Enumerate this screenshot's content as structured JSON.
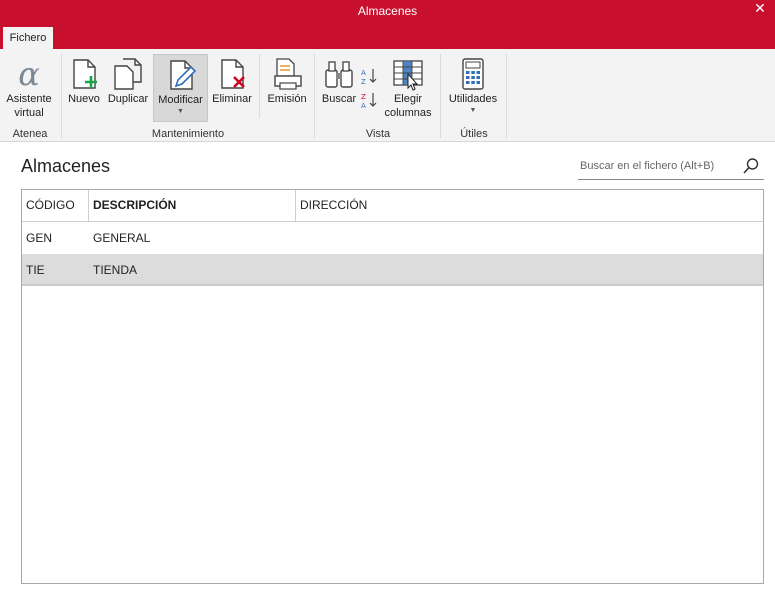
{
  "window": {
    "title": "Almacenes",
    "close_label": "✕"
  },
  "tabs": [
    {
      "label": "Fichero"
    }
  ],
  "ribbon": {
    "groups": {
      "atenea": "Atenea",
      "mantenimiento": "Mantenimiento",
      "vista": "Vista",
      "utiles": "Útiles"
    },
    "buttons": {
      "asistente_line1": "Asistente",
      "asistente_line2": "virtual",
      "nuevo": "Nuevo",
      "duplicar": "Duplicar",
      "modificar": "Modificar",
      "eliminar": "Eliminar",
      "emision": "Emisión",
      "buscar": "Buscar",
      "elegir_line1": "Elegir",
      "elegir_line2": "columnas",
      "utilidades": "Utilidades"
    },
    "colors": {
      "accent": "#c8102e",
      "add": "#1aa34a",
      "delete": "#d0021b",
      "pen": "#2f6fba"
    }
  },
  "main": {
    "title": "Almacenes",
    "search": {
      "placeholder": "Buscar en el fichero (Alt+B)"
    }
  },
  "table": {
    "columns": [
      "CÓDIGO",
      "DESCRIPCIÓN",
      "DIRECCIÓN"
    ],
    "sorted_column": "DESCRIPCIÓN",
    "rows": [
      {
        "codigo": "GEN",
        "descripcion": "GENERAL",
        "direccion": ""
      },
      {
        "codigo": "TIE",
        "descripcion": "TIENDA",
        "direccion": ""
      }
    ],
    "selected_row": 1
  }
}
